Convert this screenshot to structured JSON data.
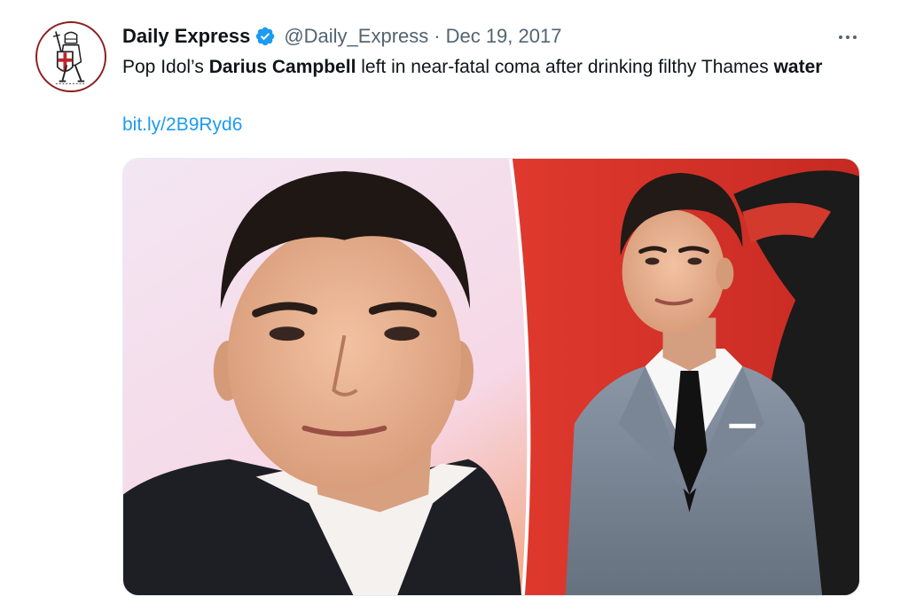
{
  "tweet": {
    "author": {
      "display_name": "Daily Express",
      "handle": "@Daily_Express",
      "verified_icon": "verified-badge-icon",
      "avatar_icon": "crusader-logo-icon"
    },
    "separator": "·",
    "date": "Dec 19, 2017",
    "more_icon": "more-options-icon",
    "text": {
      "part1": "Pop Idol’s ",
      "bold1": "Darius Campbell",
      "part2": " left in near-fatal coma after drinking filthy Thames ",
      "bold2": "water"
    },
    "link": "bit.ly/2B9Ryd6",
    "media": {
      "description_icon": "photo-collage-icon"
    }
  },
  "colors": {
    "text_primary": "#0f1419",
    "text_secondary": "#536471",
    "link": "#1d9bf0",
    "verified": "#1d9bf0",
    "background": "#ffffff"
  }
}
